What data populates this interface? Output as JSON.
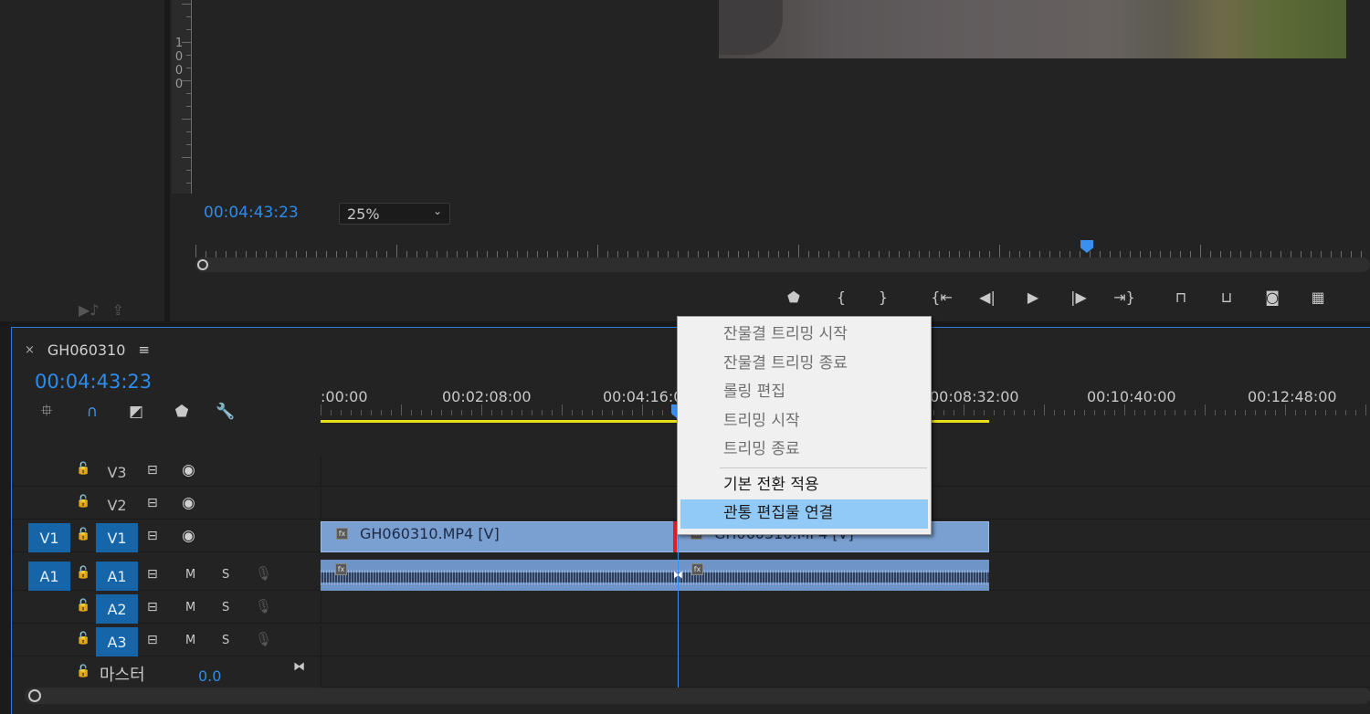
{
  "source_monitor": {
    "vruler_number": "1\n0\n0\n0",
    "timecode": "00:04:43:23",
    "zoom": "25%"
  },
  "timeline": {
    "sequence_name": "GH060310",
    "timecode": "00:04:43:23",
    "ruler_labels": [
      ":00:00",
      "00:02:08:00",
      "00:04:16:0",
      "00:08:32:00",
      "00:10:40:00",
      "00:12:48:00"
    ],
    "tracks": {
      "v3": {
        "label": "V3"
      },
      "v2": {
        "label": "V2"
      },
      "v1": {
        "source": "V1",
        "label": "V1"
      },
      "a1": {
        "source": "A1",
        "label": "A1",
        "m": "M",
        "s": "S"
      },
      "a2": {
        "label": "A2",
        "m": "M",
        "s": "S"
      },
      "a3": {
        "label": "A3",
        "m": "M",
        "s": "S"
      }
    },
    "master": {
      "label": "마스터",
      "value": "0.0"
    },
    "clips": {
      "v1_left": "GH060310.MP4 [V]",
      "v1_right": "GH060310.MP4 [V]"
    }
  },
  "context_menu": {
    "items": [
      {
        "label": "잔물결 트리밍 시작",
        "enabled": false
      },
      {
        "label": "잔물결 트리밍 종료",
        "enabled": false
      },
      {
        "label": "롤링 편집",
        "enabled": false
      },
      {
        "label": "트리밍 시작",
        "enabled": false
      },
      {
        "label": "트리밍 종료",
        "enabled": false
      }
    ],
    "items2": [
      {
        "label": "기본 전환 적용",
        "enabled": true
      },
      {
        "label": "관통 편집물 연결",
        "enabled": true,
        "hover": true
      }
    ]
  },
  "icons": {
    "close": "×",
    "menu": "≡",
    "lock": "🔓",
    "eye": "👁"
  }
}
